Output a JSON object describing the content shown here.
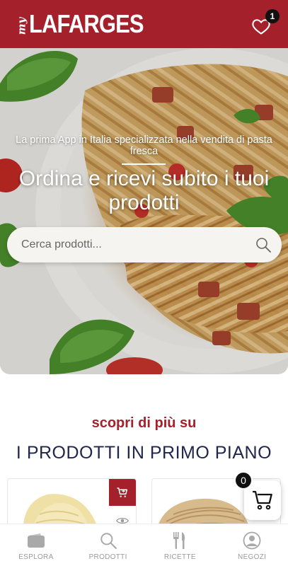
{
  "header": {
    "logo_prefix": "my",
    "logo_brand": "LAFARGES",
    "favorites_count": "1"
  },
  "hero": {
    "subtitle": "La prima App in Italia specializzata nella vendita di pasta fresca",
    "title": "Ordina e ricevi subito i tuoi prodotti",
    "search_placeholder": "Cerca prodotti..."
  },
  "section": {
    "kicker": "scopri di più su",
    "title": "I PRODOTTI IN PRIMO PIANO"
  },
  "cart": {
    "count": "0"
  },
  "tabs": [
    {
      "label": "ESPLORA",
      "icon": "wallet-icon"
    },
    {
      "label": "PRODOTTI",
      "icon": "search-icon"
    },
    {
      "label": "RICETTE",
      "icon": "cutlery-icon"
    },
    {
      "label": "NEGOZI",
      "icon": "store-user-icon"
    }
  ],
  "colors": {
    "brand": "#a4212b",
    "navy": "#20264d"
  }
}
